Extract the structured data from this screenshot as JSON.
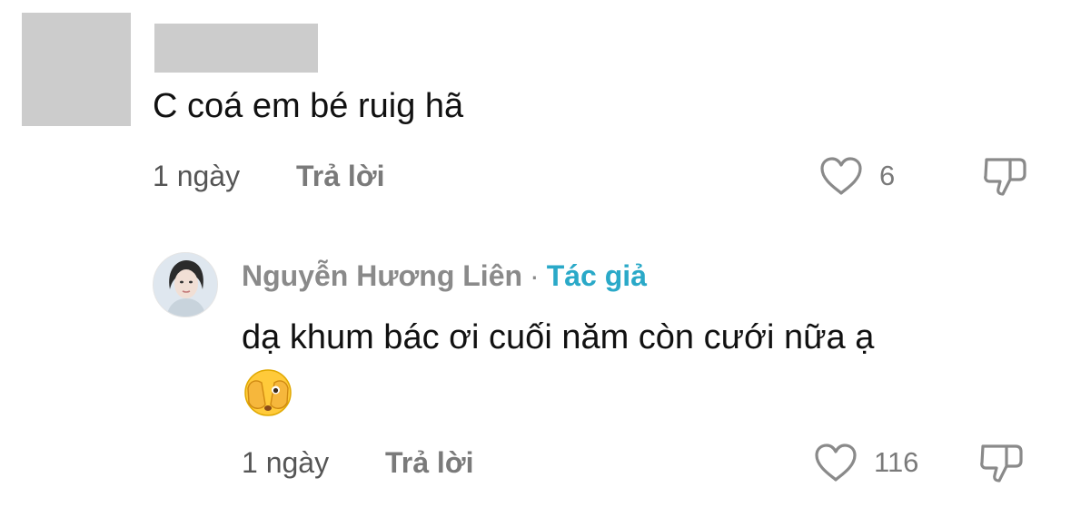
{
  "comment": {
    "text": "C coá em bé ruig hã",
    "time": "1 ngày",
    "reply_label": "Trả lời",
    "like_count": "6"
  },
  "reply": {
    "author": "Nguyễn Hương Liên",
    "separator": "·",
    "badge": "Tác giả",
    "text": "dạ khum bác ơi cuối năm còn cưới nữa ạ",
    "emoji": "face-with-hands-over-eyes-icon",
    "time": "1 ngày",
    "reply_label": "Trả lời",
    "like_count": "116"
  },
  "colors": {
    "badge": "#2aa9c8",
    "muted": "#7a7a7a",
    "redaction": "#cccccc"
  }
}
